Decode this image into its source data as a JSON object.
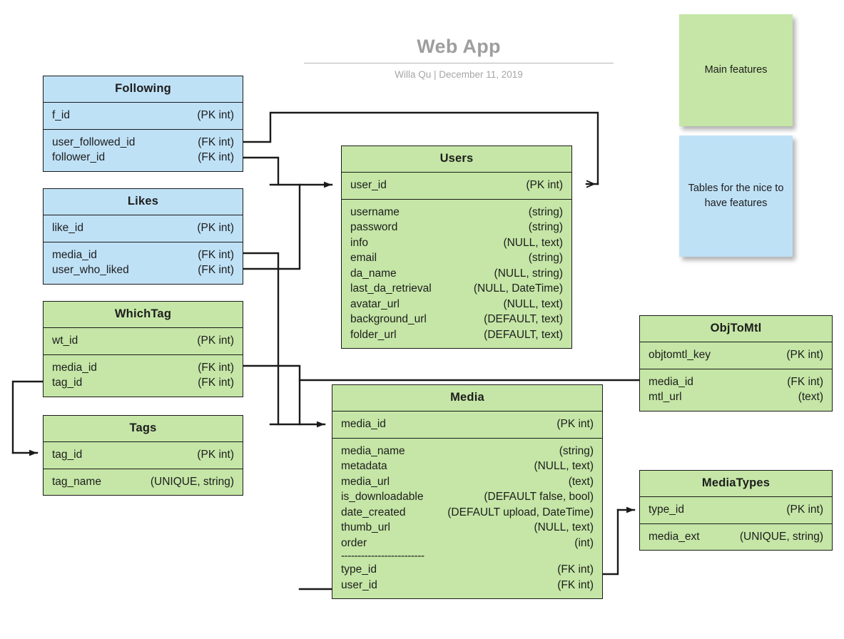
{
  "header": {
    "title": "Web App",
    "subtitle": "Willa Qu  |  December 11, 2019"
  },
  "legend": [
    {
      "label": "Main features",
      "color": "#c5e6a6"
    },
    {
      "label": "Tables for the nice to have features",
      "color": "#bfe1f6"
    }
  ],
  "colors": {
    "main_feature": "#c5e6a6",
    "nice_to_have": "#bfe1f6",
    "line": "#1a1a1a",
    "title_text": "#9e9e9e"
  },
  "tables": {
    "following": {
      "name": "Following",
      "keys": [
        {
          "field": "f_id",
          "type": "(PK int)"
        }
      ],
      "fields": [
        {
          "field": "user_followed_id",
          "type": "(FK int)"
        },
        {
          "field": "follower_id",
          "type": "(FK int)"
        }
      ]
    },
    "likes": {
      "name": "Likes",
      "keys": [
        {
          "field": "like_id",
          "type": "(PK int)"
        }
      ],
      "fields": [
        {
          "field": "media_id",
          "type": "(FK int)"
        },
        {
          "field": "user_who_liked",
          "type": "(FK int)"
        }
      ]
    },
    "whichtag": {
      "name": "WhichTag",
      "keys": [
        {
          "field": "wt_id",
          "type": "(PK int)"
        }
      ],
      "fields": [
        {
          "field": "media_id",
          "type": "(FK int)"
        },
        {
          "field": "tag_id",
          "type": "(FK int)"
        }
      ]
    },
    "tags": {
      "name": "Tags",
      "keys": [
        {
          "field": "tag_id",
          "type": "(PK int)"
        }
      ],
      "fields": [
        {
          "field": "tag_name",
          "type": "(UNIQUE, string)"
        }
      ]
    },
    "users": {
      "name": "Users",
      "keys": [
        {
          "field": "user_id",
          "type": "(PK int)"
        }
      ],
      "fields": [
        {
          "field": "username",
          "type": "(string)"
        },
        {
          "field": "password",
          "type": "(string)"
        },
        {
          "field": "info",
          "type": "(NULL, text)"
        },
        {
          "field": "email",
          "type": "(string)"
        },
        {
          "field": "da_name",
          "type": "(NULL, string)"
        },
        {
          "field": "last_da_retrieval",
          "type": "(NULL, DateTime)"
        },
        {
          "field": "avatar_url",
          "type": "(NULL, text)"
        },
        {
          "field": "background_url",
          "type": "(DEFAULT, text)"
        },
        {
          "field": "folder_url",
          "type": "(DEFAULT, text)"
        }
      ]
    },
    "media": {
      "name": "Media",
      "keys": [
        {
          "field": "media_id",
          "type": "(PK int)"
        }
      ],
      "fields": [
        {
          "field": "media_name",
          "type": "(string)"
        },
        {
          "field": "metadata",
          "type": "(NULL, text)"
        },
        {
          "field": "media_url",
          "type": "(text)"
        },
        {
          "field": "is_downloadable",
          "type": "(DEFAULT false, bool)"
        },
        {
          "field": "date_created",
          "type": "(DEFAULT upload, DateTime)"
        },
        {
          "field": "thumb_url",
          "type": "(NULL, text)"
        },
        {
          "field": "order",
          "type": "(int)"
        }
      ],
      "separator": "-------------------------",
      "foreign_keys": [
        {
          "field": "type_id",
          "type": "(FK int)"
        },
        {
          "field": "user_id",
          "type": "(FK int)"
        }
      ]
    },
    "objtomtl": {
      "name": "ObjToMtl",
      "keys": [
        {
          "field": "objtomtl_key",
          "type": "(PK int)"
        }
      ],
      "fields": [
        {
          "field": "media_id",
          "type": "(FK int)"
        },
        {
          "field": "mtl_url",
          "type": "(text)"
        }
      ]
    },
    "mediatypes": {
      "name": "MediaTypes",
      "keys": [
        {
          "field": "type_id",
          "type": "(PK int)"
        }
      ],
      "fields": [
        {
          "field": "media_ext",
          "type": "(UNIQUE, string)"
        }
      ]
    }
  }
}
